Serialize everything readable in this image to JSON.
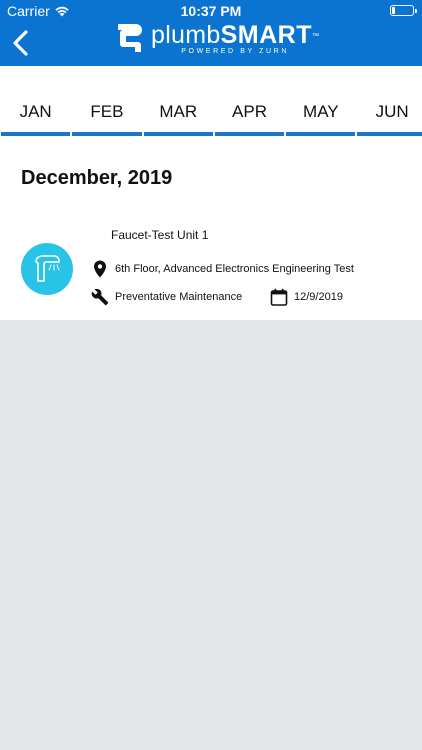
{
  "status_bar": {
    "carrier": "Carrier",
    "time": "10:37 PM",
    "battery_level": 0.15
  },
  "header": {
    "logo_word_light": "plumb",
    "logo_word_bold": "SMART",
    "logo_trademark": "™",
    "logo_tagline": "POWERED BY ZURN",
    "background_color": "#0a74d0"
  },
  "months": [
    {
      "label": "JAN"
    },
    {
      "label": "FEB"
    },
    {
      "label": "MAR"
    },
    {
      "label": "APR"
    },
    {
      "label": "MAY"
    },
    {
      "label": "JUN"
    }
  ],
  "main": {
    "heading": "December, 2019",
    "device": {
      "name": "Faucet-Test Unit 1",
      "location": "6th Floor, Advanced Electronics Engineering Test",
      "service_type": "Preventative Maintenance",
      "date": "12/9/2019",
      "icon": "faucet-icon",
      "avatar_color": "#29c3e8"
    }
  },
  "colors": {
    "accent": "#1a77c8",
    "background": "#e5e6e8"
  }
}
